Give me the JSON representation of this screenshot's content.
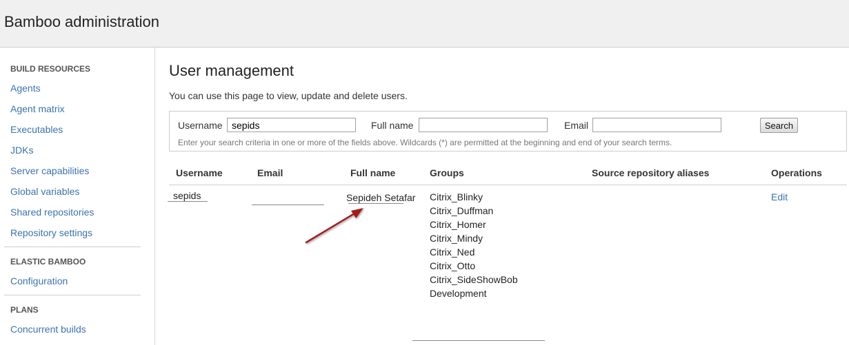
{
  "header": {
    "title": "Bamboo administration"
  },
  "sidebar": {
    "sections": [
      {
        "heading": "BUILD RESOURCES",
        "items": [
          "Agents",
          "Agent matrix",
          "Executables",
          "JDKs",
          "Server capabilities",
          "Global variables",
          "Shared repositories",
          "Repository settings"
        ]
      },
      {
        "heading": "ELASTIC BAMBOO",
        "items": [
          "Configuration"
        ]
      },
      {
        "heading": "PLANS",
        "items": [
          "Concurrent builds"
        ]
      }
    ]
  },
  "main": {
    "title": "User management",
    "description": "You can use this page to view, update and delete users.",
    "search": {
      "username_label": "Username",
      "username_value": "sepids",
      "fullname_label": "Full name",
      "fullname_value": "",
      "email_label": "Email",
      "email_value": "",
      "button_label": "Search",
      "hint": "Enter your search criteria in one or more of the fields above. Wildcards (*) are permitted at the beginning and end of your search terms."
    },
    "table": {
      "headers": [
        "Username",
        "Email",
        "Full name",
        "Groups",
        "Source repository aliases",
        "Operations"
      ],
      "rows": [
        {
          "username": "sepids",
          "email": "",
          "full_name": "Sepideh Setafar",
          "groups": [
            "Citrix_Blinky",
            "Citrix_Duffman",
            "Citrix_Homer",
            "Citrix_Mindy",
            "Citrix_Ned",
            "Citrix_Otto",
            "Citrix_SideShowBob",
            "Development"
          ],
          "source_repository_aliases": "",
          "operation": "Edit"
        }
      ]
    }
  },
  "colors": {
    "link": "#3b73af",
    "arrow": "#a31d1d",
    "header_bg": "#f0f0f0"
  }
}
